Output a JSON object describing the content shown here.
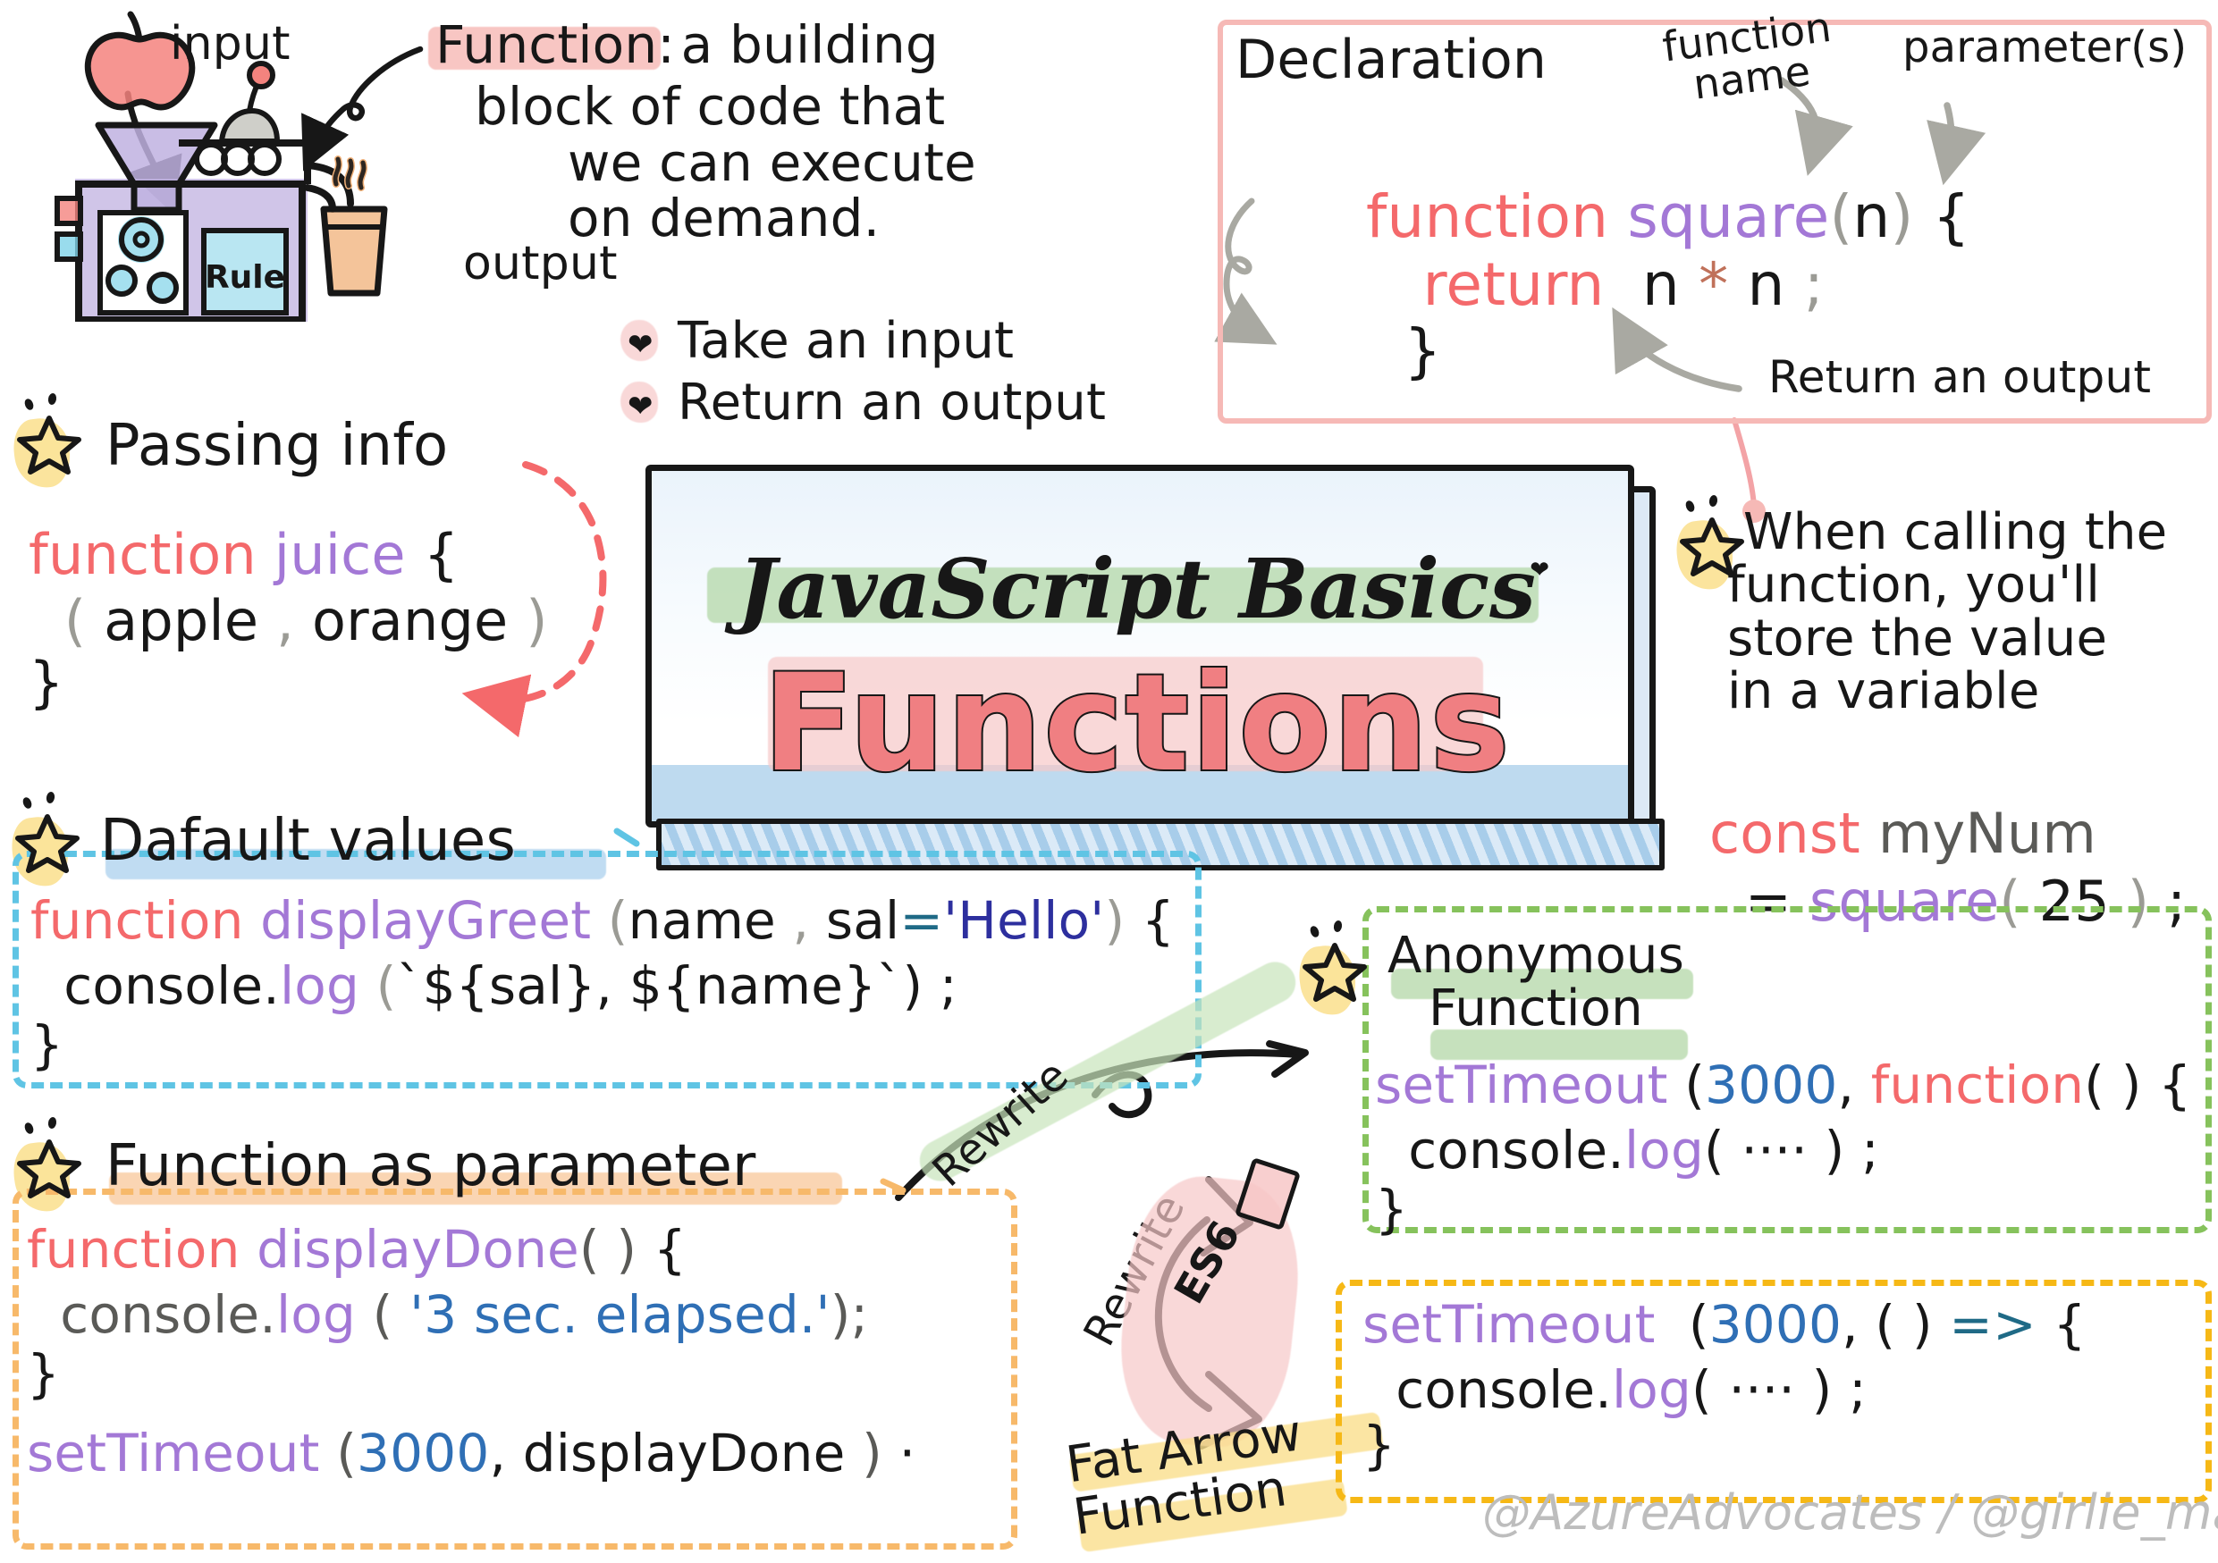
{
  "meta": {
    "title": "JavaScript Basics — Functions sketchnote",
    "credit": "@AzureAdvocates / @girlie_mac"
  },
  "title_card": {
    "subtitle": "JavaScript Basics",
    "title": "Functions"
  },
  "intro": {
    "input_label": "input",
    "output_label": "output",
    "machine_rule_label": "Rule",
    "definition_highlight": "Function:",
    "definition_rest_line1": " a building",
    "definition_line2": "block of code that",
    "definition_line3": "we can execute",
    "definition_line4": "on demand.",
    "bullets": [
      {
        "icon": "heart-icon",
        "text": "Take an input"
      },
      {
        "icon": "heart-icon",
        "text": "Return an output"
      }
    ]
  },
  "declaration": {
    "heading": "Declaration",
    "annotation_function_name": "function\nname",
    "annotation_parameters": "parameter(s)",
    "annotation_return": "Return an output",
    "code": {
      "line1": [
        {
          "t": "function",
          "c": "red"
        },
        {
          "t": " ",
          "c": "dark"
        },
        {
          "t": "square",
          "c": "purple"
        },
        {
          "t": "(",
          "c": "grey"
        },
        {
          "t": "n",
          "c": "dark"
        },
        {
          "t": ")",
          "c": "grey"
        },
        {
          "t": " {",
          "c": "dark"
        }
      ],
      "line2": [
        {
          "t": "   return",
          "c": "red"
        },
        {
          "t": "  n ",
          "c": "dark"
        },
        {
          "t": "*",
          "c": "brown"
        },
        {
          "t": " n",
          "c": "dark"
        },
        {
          "t": " ;",
          "c": "grey"
        }
      ],
      "line3": [
        {
          "t": "  }",
          "c": "dark"
        }
      ]
    }
  },
  "passing_info": {
    "heading": "Passing info",
    "code": {
      "line1": [
        {
          "t": "function",
          "c": "red"
        },
        {
          "t": " ",
          "c": "dark"
        },
        {
          "t": "juice",
          "c": "purple"
        },
        {
          "t": " {",
          "c": "dark"
        }
      ],
      "line2": [
        {
          "t": "  (",
          "c": "grey"
        },
        {
          "t": " apple ",
          "c": "dark"
        },
        {
          "t": ",",
          "c": "grey"
        },
        {
          "t": " orange ",
          "c": "dark"
        },
        {
          "t": ")",
          "c": "grey"
        }
      ],
      "line3": [
        {
          "t": "}",
          "c": "dark"
        }
      ]
    }
  },
  "calling": {
    "line1": "When calling the",
    "line2": "function, you'll",
    "line3": "store the value",
    "line4": "in a variable",
    "code": {
      "line1": [
        {
          "t": "const",
          "c": "red"
        },
        {
          "t": " ",
          "c": "dark"
        },
        {
          "t": "myNum",
          "c": "dgrey"
        }
      ],
      "line2": [
        {
          "t": "  = ",
          "c": "dark"
        },
        {
          "t": "square",
          "c": "purple"
        },
        {
          "t": "(",
          "c": "grey"
        },
        {
          "t": " 25 ",
          "c": "dark"
        },
        {
          "t": ")",
          "c": "grey"
        },
        {
          "t": " ;",
          "c": "dark"
        }
      ]
    }
  },
  "default_values": {
    "heading": "Dafault values",
    "code": {
      "line1": [
        {
          "t": "function",
          "c": "red"
        },
        {
          "t": " ",
          "c": "dark"
        },
        {
          "t": "displayGreet",
          "c": "purple"
        },
        {
          "t": " (",
          "c": "grey"
        },
        {
          "t": "name ",
          "c": "dark"
        },
        {
          "t": ",",
          "c": "grey"
        },
        {
          "t": " sal",
          "c": "dark"
        },
        {
          "t": "=",
          "c": "teal"
        },
        {
          "t": "'Hello'",
          "c": "navy"
        },
        {
          "t": ")",
          "c": "grey"
        },
        {
          "t": " {",
          "c": "dark"
        }
      ],
      "line2": [
        {
          "t": "  console.",
          "c": "dark"
        },
        {
          "t": "log",
          "c": "purple"
        },
        {
          "t": " (",
          "c": "grey"
        },
        {
          "t": "`${sal}, ${name}`",
          "c": "dark"
        },
        {
          "t": ")",
          "c": "dark"
        },
        {
          "t": " ;",
          "c": "dark"
        }
      ],
      "line3": [
        {
          "t": "}",
          "c": "dark"
        }
      ]
    }
  },
  "function_as_parameter": {
    "heading": "Function as parameter",
    "code": {
      "line1": [
        {
          "t": "function",
          "c": "red"
        },
        {
          "t": " ",
          "c": "dark"
        },
        {
          "t": "displayDone",
          "c": "purple"
        },
        {
          "t": "( )",
          "c": "dgrey"
        },
        {
          "t": " {",
          "c": "dark"
        }
      ],
      "line2": [
        {
          "t": "  console.",
          "c": "dgrey"
        },
        {
          "t": "log",
          "c": "purple"
        },
        {
          "t": " (",
          "c": "dgrey"
        },
        {
          "t": " '3 sec. elapsed.'",
          "c": "blue"
        },
        {
          "t": ")",
          "c": "dgrey"
        },
        {
          "t": ";",
          "c": "dgrey"
        }
      ],
      "line3": [
        {
          "t": "}",
          "c": "dark"
        }
      ],
      "line4": [
        {
          "t": "setTimeout",
          "c": "purple"
        },
        {
          "t": " (",
          "c": "dgrey"
        },
        {
          "t": "3000",
          "c": "blue"
        },
        {
          "t": ",",
          "c": "dark"
        },
        {
          "t": " displayDone ",
          "c": "dark"
        },
        {
          "t": ")",
          "c": "dgrey"
        },
        {
          "t": " ·",
          "c": "dark"
        }
      ]
    }
  },
  "anonymous": {
    "heading_line1": "Anonymous",
    "heading_line2": "Function",
    "code": {
      "line1": [
        {
          "t": "setTimeout",
          "c": "purple"
        },
        {
          "t": " (",
          "c": "dark"
        },
        {
          "t": "3000",
          "c": "blue"
        },
        {
          "t": ", ",
          "c": "dark"
        },
        {
          "t": "function",
          "c": "red"
        },
        {
          "t": "( ) {",
          "c": "dark"
        }
      ],
      "line2": [
        {
          "t": "  console.",
          "c": "dark"
        },
        {
          "t": "log",
          "c": "purple"
        },
        {
          "t": "( ···· )",
          "c": "dark"
        },
        {
          "t": " ;",
          "c": "dark"
        }
      ],
      "line3": [
        {
          "t": "}",
          "c": "dark"
        }
      ]
    }
  },
  "rewrite_flow": {
    "label_rewrite_1": "Rewrite",
    "label_rewrite_2": "Rewrite",
    "label_es6": "ES6",
    "label_fat_arrow_line1": "Fat Arrow",
    "label_fat_arrow_line2": "Function"
  },
  "fat_arrow": {
    "code": {
      "line1": [
        {
          "t": "setTimeout",
          "c": "purple"
        },
        {
          "t": "  (",
          "c": "dark"
        },
        {
          "t": "3000",
          "c": "blue"
        },
        {
          "t": ", ( ) ",
          "c": "dark"
        },
        {
          "t": "=>",
          "c": "teal"
        },
        {
          "t": " {",
          "c": "dark"
        }
      ],
      "line2": [
        {
          "t": "  console.",
          "c": "dark"
        },
        {
          "t": "log",
          "c": "purple"
        },
        {
          "t": "( ···· )",
          "c": "dark"
        },
        {
          "t": " ;",
          "c": "dark"
        }
      ],
      "line3": [
        {
          "t": "}",
          "c": "dark"
        }
      ]
    }
  },
  "colors": {
    "keyword_red": "#f4696b",
    "identifier_purple": "#a378d6",
    "string_blue": "#2d2f9e",
    "number_blue": "#2f6fb5",
    "punctuation_grey": "#9b9b95",
    "highlight_pink": "#f6b6b2",
    "highlight_green": "#b0d6a3",
    "highlight_blue": "#a8ceed",
    "highlight_orange": "#f9cba0",
    "highlight_yellow": "#fadf8c",
    "frame_cyan": "#5fc4e4",
    "frame_orange": "#f7b96a",
    "frame_green": "#86c25c",
    "frame_yellow": "#f6b816",
    "frame_pink": "#f6b9b6"
  }
}
